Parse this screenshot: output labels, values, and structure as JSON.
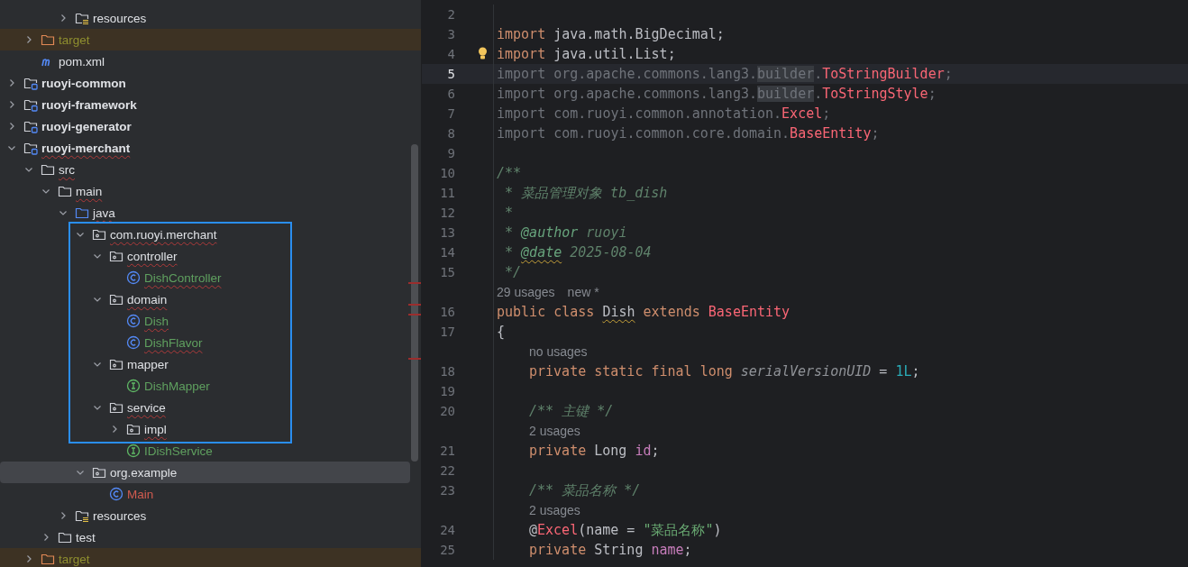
{
  "project_tree": {
    "items": [
      {
        "children": [
          {
            "children": [
              {
                "children": [
                  {
                    "label": "resources",
                    "kind": "resources",
                    "expanded": false,
                    "selected": false
                  }
                ]
              }
            ]
          },
          {
            "label": "target",
            "kind": "excluded",
            "expanded": false,
            "selected": false,
            "color": "#8f8f2f"
          },
          {
            "label": "pom.xml",
            "kind": "maven",
            "selected": false
          }
        ]
      },
      {
        "label": "ruoyi-common",
        "kind": "module",
        "expanded": false,
        "selected": false
      },
      {
        "label": "ruoyi-framework",
        "kind": "module",
        "expanded": false,
        "selected": false
      },
      {
        "label": "ruoyi-generator",
        "kind": "module",
        "expanded": false,
        "selected": false
      },
      {
        "label": "ruoyi-merchant",
        "kind": "module",
        "expanded": true,
        "selected": false,
        "typo": true,
        "children": [
          {
            "label": "src",
            "kind": "folder",
            "expanded": true,
            "selected": false,
            "typo": true,
            "children": [
              {
                "label": "main",
                "kind": "folder",
                "expanded": true,
                "selected": false,
                "typo": true,
                "children": [
                  {
                    "label": "java",
                    "kind": "source",
                    "expanded": true,
                    "selected": false,
                    "typo": true,
                    "children": [
                      {
                        "label": "com.ruoyi.merchant",
                        "kind": "package",
                        "expanded": true,
                        "selected": false,
                        "typo": true,
                        "children": [
                          {
                            "label": "controller",
                            "kind": "package",
                            "expanded": true,
                            "selected": false,
                            "typo": true,
                            "children": [
                              {
                                "label": "DishController",
                                "kind": "class",
                                "selected": false,
                                "typo": true,
                                "color": "#5fa05f"
                              }
                            ]
                          },
                          {
                            "label": "domain",
                            "kind": "package",
                            "expanded": true,
                            "selected": false,
                            "typo": true,
                            "children": [
                              {
                                "label": "Dish",
                                "kind": "class",
                                "selected": false,
                                "typo": true,
                                "color": "#5fa05f"
                              },
                              {
                                "label": "DishFlavor",
                                "kind": "class",
                                "selected": false,
                                "typo": true,
                                "color": "#5fa05f"
                              }
                            ]
                          },
                          {
                            "label": "mapper",
                            "kind": "package",
                            "expanded": true,
                            "selected": false,
                            "children": [
                              {
                                "label": "DishMapper",
                                "kind": "interface",
                                "selected": false,
                                "color": "#5fa05f"
                              }
                            ]
                          },
                          {
                            "label": "service",
                            "kind": "package",
                            "expanded": true,
                            "selected": false,
                            "typo": true,
                            "children": [
                              {
                                "label": "impl",
                                "kind": "package",
                                "expanded": false,
                                "selected": false,
                                "typo": true
                              },
                              {
                                "label": "IDishService",
                                "kind": "interface",
                                "selected": false,
                                "color": "#5fa05f"
                              }
                            ]
                          }
                        ]
                      },
                      {
                        "label": "org.example",
                        "kind": "package",
                        "expanded": true,
                        "selected": true,
                        "children": [
                          {
                            "label": "Main",
                            "kind": "class",
                            "selected": false,
                            "color": "#d15b4f"
                          }
                        ]
                      }
                    ]
                  },
                  {
                    "label": "resources",
                    "kind": "resources",
                    "expanded": false,
                    "selected": false
                  }
                ]
              },
              {
                "label": "test",
                "kind": "folder",
                "expanded": false,
                "selected": false
              }
            ]
          },
          {
            "label": "target",
            "kind": "excluded",
            "expanded": false,
            "selected": false,
            "color": "#8f8f2f"
          }
        ]
      }
    ]
  },
  "editor": {
    "lines": [
      {
        "num": "2"
      },
      {
        "num": "3",
        "tokens": [
          {
            "t": "import ",
            "kind": "keyword"
          },
          {
            "t": "java.math.BigDecimal;",
            "kind": "plain"
          }
        ]
      },
      {
        "num": "4",
        "bulb": true,
        "tokens": [
          {
            "t": "import ",
            "kind": "keyword"
          },
          {
            "t": "java.util.List;",
            "kind": "plain"
          }
        ]
      },
      {
        "num": "5",
        "current": true,
        "tokens": [
          {
            "t": "import org.apache.commons.lang3.",
            "kind": "unused"
          },
          {
            "t": "builder",
            "kind": "unused",
            "occurrence": true
          },
          {
            "t": ".",
            "kind": "unused"
          },
          {
            "t": "ToStringBuilder",
            "kind": "error"
          },
          {
            "t": ";",
            "kind": "unused"
          }
        ]
      },
      {
        "num": "6",
        "tokens": [
          {
            "t": "import org.apache.commons.lang3.",
            "kind": "unused"
          },
          {
            "t": "builder",
            "kind": "unused",
            "occurrence": true
          },
          {
            "t": ".",
            "kind": "unused"
          },
          {
            "t": "ToStringStyle",
            "kind": "error"
          },
          {
            "t": ";",
            "kind": "unused"
          }
        ]
      },
      {
        "num": "7",
        "tokens": [
          {
            "t": "import com.ruoyi.common.annotation.",
            "kind": "unused"
          },
          {
            "t": "Excel",
            "kind": "error"
          },
          {
            "t": ";",
            "kind": "unused"
          }
        ]
      },
      {
        "num": "8",
        "tokens": [
          {
            "t": "import com.ruoyi.common.core.domain.",
            "kind": "unused"
          },
          {
            "t": "BaseEntity",
            "kind": "error"
          },
          {
            "t": ";",
            "kind": "unused"
          }
        ]
      },
      {
        "num": "9"
      },
      {
        "num": "10",
        "tokens": [
          {
            "t": "/**",
            "kind": "comment"
          }
        ]
      },
      {
        "num": "11",
        "tokens": [
          {
            "t": " * 菜品管理对象 tb_dish",
            "kind": "comment"
          }
        ]
      },
      {
        "num": "12",
        "tokens": [
          {
            "t": " *",
            "kind": "comment"
          }
        ]
      },
      {
        "num": "13",
        "tokens": [
          {
            "t": " * ",
            "kind": "comment"
          },
          {
            "t": "@author",
            "kind": "doctag"
          },
          {
            "t": " ruoyi",
            "kind": "comment"
          }
        ]
      },
      {
        "num": "14",
        "tokens": [
          {
            "t": " * ",
            "kind": "comment"
          },
          {
            "t": "@date",
            "kind": "doctag",
            "warn": true
          },
          {
            "t": " 2025-08-04",
            "kind": "comment"
          }
        ]
      },
      {
        "num": "15",
        "tokens": [
          {
            "t": " */",
            "kind": "comment"
          }
        ]
      },
      {
        "kind": "hint",
        "parts": [
          "29 usages",
          "new *"
        ]
      },
      {
        "num": "16",
        "tokens": [
          {
            "t": "public class ",
            "kind": "keyword"
          },
          {
            "t": "Dish",
            "kind": "plain",
            "warn": true
          },
          {
            "t": " extends ",
            "kind": "keyword"
          },
          {
            "t": "BaseEntity",
            "kind": "error"
          }
        ]
      },
      {
        "num": "17",
        "tokens": [
          {
            "t": "{",
            "kind": "plain"
          }
        ],
        "children": [
          {
            "kind": "hint",
            "parts": [
              "no usages"
            ]
          },
          {
            "num": "18",
            "tokens": [
              {
                "t": "private static final long ",
                "kind": "keyword"
              },
              {
                "t": "serialVersionUID",
                "kind": "static"
              },
              {
                "t": " = ",
                "kind": "plain"
              },
              {
                "t": "1L",
                "kind": "number"
              },
              {
                "t": ";",
                "kind": "plain"
              }
            ]
          },
          {
            "num": "19"
          },
          {
            "num": "20",
            "tokens": [
              {
                "t": "/** 主键 */",
                "kind": "comment"
              }
            ]
          },
          {
            "kind": "hint",
            "parts": [
              "2 usages"
            ]
          },
          {
            "num": "21",
            "tokens": [
              {
                "t": "private ",
                "kind": "keyword"
              },
              {
                "t": "Long ",
                "kind": "plain"
              },
              {
                "t": "id",
                "kind": "field"
              },
              {
                "t": ";",
                "kind": "plain"
              }
            ]
          },
          {
            "num": "22"
          },
          {
            "num": "23",
            "tokens": [
              {
                "t": "/** 菜品名称 */",
                "kind": "comment"
              }
            ]
          },
          {
            "kind": "hint",
            "parts": [
              "2 usages"
            ]
          },
          {
            "num": "24",
            "tokens": [
              {
                "t": "@",
                "kind": "plain"
              },
              {
                "t": "Excel",
                "kind": "error"
              },
              {
                "t": "(name = ",
                "kind": "plain"
              },
              {
                "t": "\"菜品名称\"",
                "kind": "string"
              },
              {
                "t": ")",
                "kind": "plain"
              }
            ]
          },
          {
            "num": "25",
            "tokens": [
              {
                "t": "private ",
                "kind": "keyword"
              },
              {
                "t": "String ",
                "kind": "plain"
              },
              {
                "t": "name",
                "kind": "field"
              },
              {
                "t": ";",
                "kind": "plain"
              }
            ]
          }
        ]
      }
    ]
  }
}
